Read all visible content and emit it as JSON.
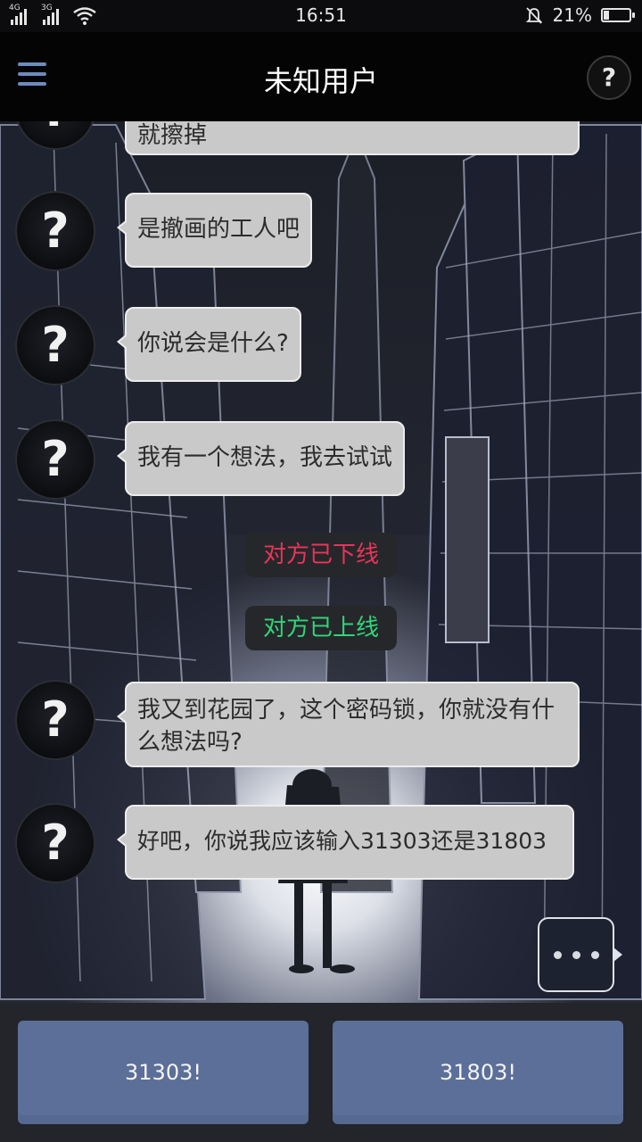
{
  "status_bar": {
    "network_1": "4G",
    "network_2": "3G",
    "time": "16:51",
    "battery_percent": "21%",
    "battery_level": 0.21
  },
  "header": {
    "title": "未知用户",
    "help_icon": "?"
  },
  "chat": {
    "avatar_glyph": "?",
    "messages": [
      {
        "from": "unknown",
        "text": "就擦掉"
      },
      {
        "from": "unknown",
        "text": "是撤画的工人吧"
      },
      {
        "from": "unknown",
        "text": "你说会是什么?"
      },
      {
        "from": "unknown",
        "text": "我有一个想法，我去试试"
      },
      {
        "from": "system",
        "text": "对方已下线",
        "color": "#e9345a"
      },
      {
        "from": "system",
        "text": "对方已上线",
        "color": "#2fd67a"
      },
      {
        "from": "unknown",
        "text": "我又到花园了，这个密码锁，你就没有什么想法吗?"
      },
      {
        "from": "unknown",
        "text": "好吧，你说我应该输入31303还是31803"
      }
    ]
  },
  "choices": [
    {
      "label": "31303!"
    },
    {
      "label": "31803!"
    }
  ],
  "colors": {
    "header_bg": "#040404",
    "bubble_bg": "#c9c9c9",
    "choice_bg": "#5b6f98",
    "offline": "#e9345a",
    "online": "#2fd67a"
  }
}
